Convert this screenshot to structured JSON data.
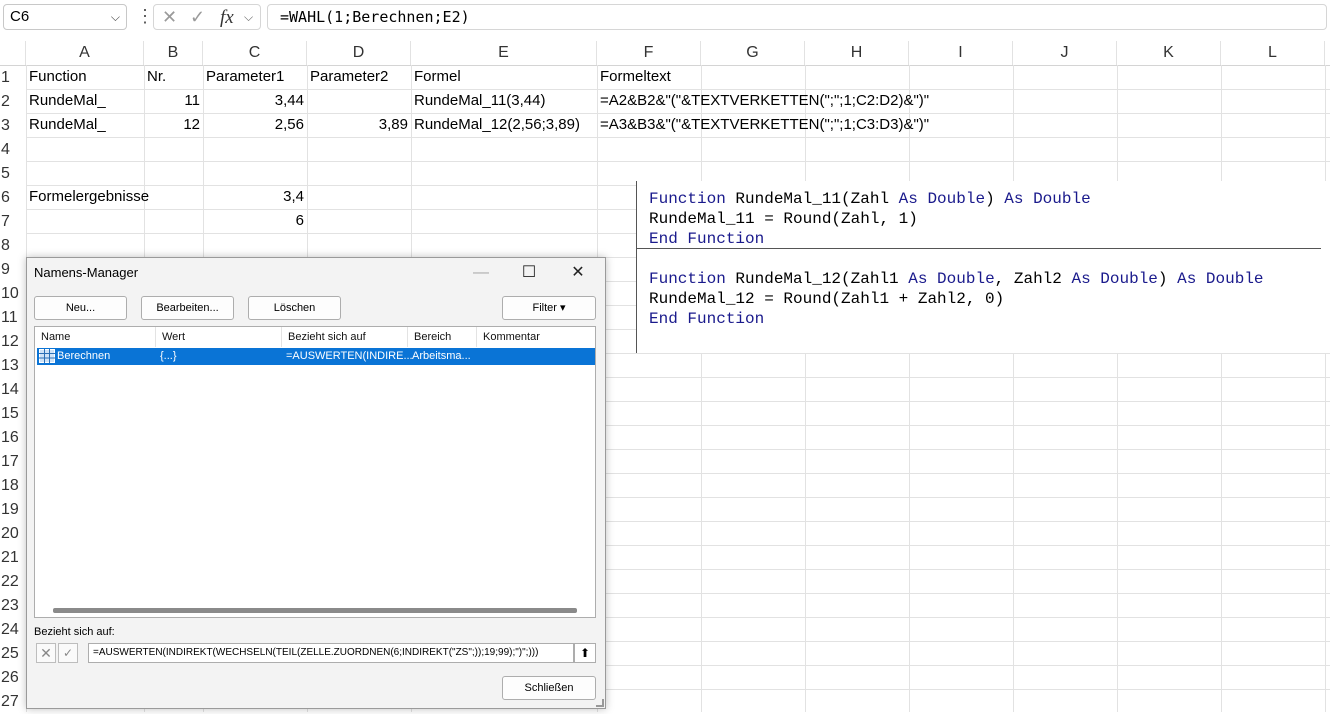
{
  "formula_bar": {
    "name_box": "C6",
    "chevron": "⌵",
    "more_dots": "⋮",
    "cancel_symbol": "✕",
    "enter_symbol": "✓",
    "fx_label": "fx",
    "formula": "=WAHL(1;Berechnen;E2)"
  },
  "columns": [
    "A",
    "B",
    "C",
    "D",
    "E",
    "F",
    "G",
    "H",
    "I",
    "J",
    "K",
    "L"
  ],
  "rows": [
    "1",
    "2",
    "3",
    "4",
    "5",
    "6",
    "7",
    "8",
    "9",
    "10",
    "11",
    "12",
    "13",
    "14",
    "15",
    "16",
    "17",
    "18",
    "19",
    "20",
    "21",
    "22",
    "23",
    "24",
    "25",
    "26",
    "27"
  ],
  "cells": {
    "A1": "Function",
    "B1": "Nr.",
    "C1": "Parameter1",
    "D1": "Parameter2",
    "E1": "Formel",
    "F1": "Formeltext",
    "A2": "RundeMal_",
    "B2": "11",
    "C2": "3,44",
    "D2": "",
    "E2": "RundeMal_11(3,44)",
    "F2": "=A2&B2&\"(\"&TEXTVERKETTEN(\";\";1;C2:D2)&\")\"",
    "A3": "RundeMal_",
    "B3": "12",
    "C3": "2,56",
    "D3": "3,89",
    "E3": "RundeMal_12(2,56;3,89)",
    "F3": "=A3&B3&\"(\"&TEXTVERKETTEN(\";\";1;C3:D3)&\")\"",
    "A6": "Formelergebnisse",
    "C6": "3,4",
    "C7": "6"
  },
  "code": {
    "l1_kw1": "Function",
    "l1_text": " RundeMal_11(Zahl ",
    "l1_kw2": "As Double",
    "l1_text2": ") ",
    "l1_kw3": "As Double",
    "l2": "RundeMal_11 = Round(Zahl, 1)",
    "l3": "End Function",
    "l4_kw1": "Function",
    "l4_text": " RundeMal_12(Zahl1 ",
    "l4_kw2": "As Double",
    "l4_text2": ", Zahl2 ",
    "l4_kw3": "As Double",
    "l4_text3": ") ",
    "l4_kw4": "As Double",
    "l5": "RundeMal_12 = Round(Zahl1 + Zahl2, 0)",
    "l6": "End Function"
  },
  "dialog": {
    "title": "Namens-Manager",
    "minimize": "—",
    "maximize": "☐",
    "close": "✕",
    "buttons": {
      "new": "Neu...",
      "edit": "Bearbeiten...",
      "delete": "Löschen",
      "filter": "Filter ▾"
    },
    "list_headers": [
      "Name",
      "Wert",
      "Bezieht sich auf",
      "Bereich",
      "Kommentar"
    ],
    "selected_row": {
      "name": "Berechnen",
      "value": "{...}",
      "refers_to": "=AUSWERTEN(INDIRE...",
      "scope": "Arbeitsma..."
    },
    "refers_label": "Bezieht sich auf:",
    "refers_value": "=AUSWERTEN(INDIREKT(WECHSELN(TEIL(ZELLE.ZUORDNEN(6;INDIREKT(\"ZS\";));19;99);\")\";)))",
    "collapse_symbol": "⬆",
    "close_button": "Schließen"
  },
  "colors": {
    "selection": "#0a74d6",
    "code_keyword": "#1a1a8c"
  }
}
